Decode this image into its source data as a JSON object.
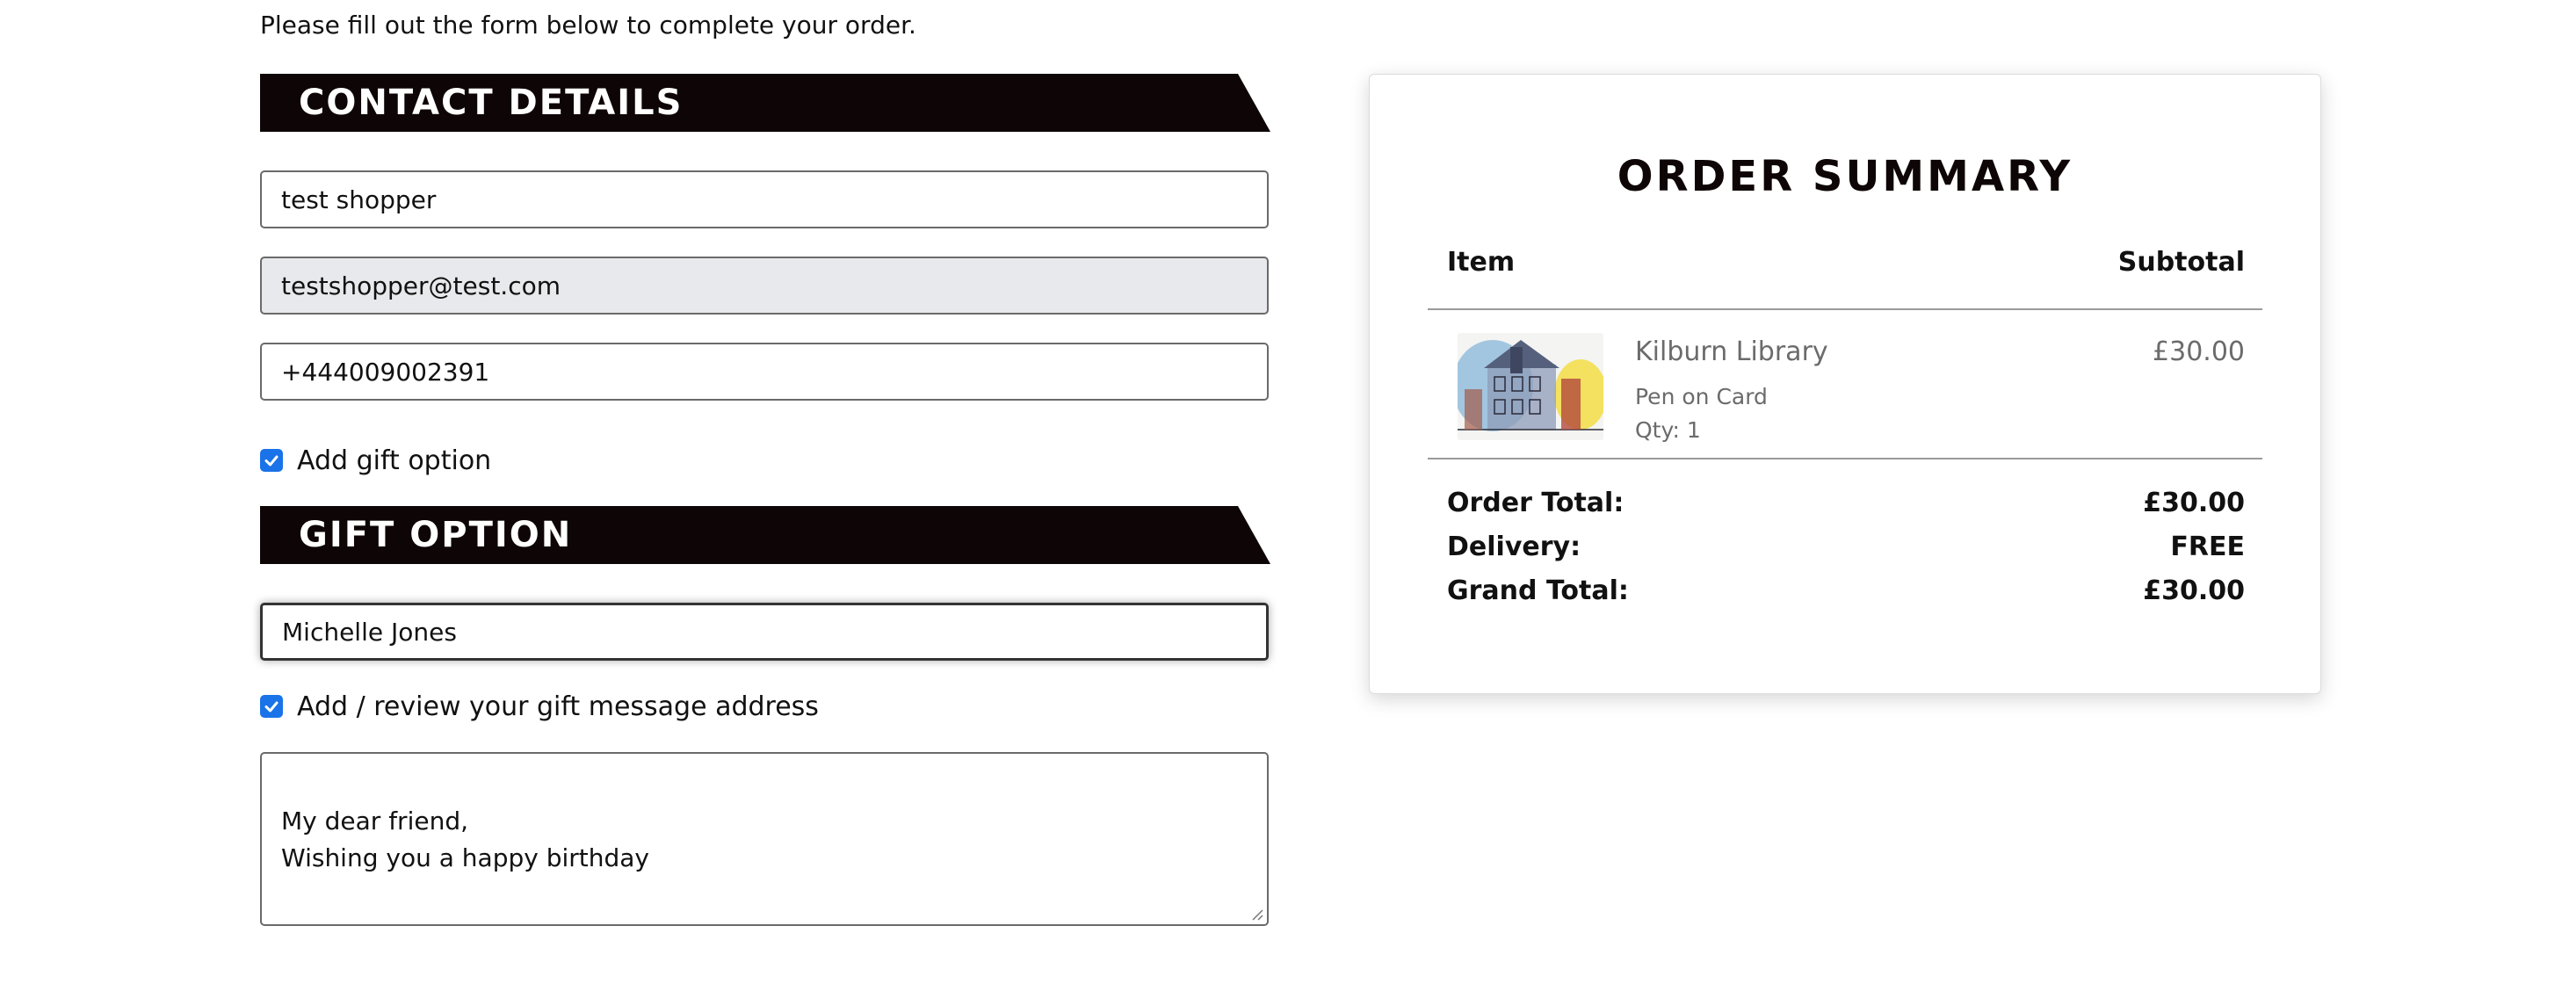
{
  "intro_text": "Please fill out the form below to complete your order.",
  "contact": {
    "heading": "Contact Details",
    "name_value": "test shopper",
    "email_value": "testshopper@test.com",
    "phone_value": "+444009002391"
  },
  "gift_toggle": {
    "label": "Add gift option",
    "checked": true
  },
  "gift": {
    "heading": "Gift Option",
    "recipient_value": "Michelle Jones",
    "message_toggle_label": "Add / review your gift message address",
    "message_toggle_checked": true,
    "message_value": "My dear friend,\nWishing you a happy birthday"
  },
  "summary": {
    "title": "Order Summary",
    "col_item": "Item",
    "col_subtotal": "Subtotal",
    "item": {
      "name": "Kilburn Library",
      "variant": "Pen on Card",
      "qty": "Qty: 1",
      "price": "£30.00"
    },
    "order_total_label": "Order Total:",
    "order_total_value": "£30.00",
    "delivery_label": "Delivery:",
    "delivery_value": "FREE",
    "grand_total_label": "Grand Total:",
    "grand_total_value": "£30.00"
  },
  "colors": {
    "banner": "#0e0506",
    "checkbox": "#1a73e8",
    "readonly_field": "#e8e9ec"
  }
}
